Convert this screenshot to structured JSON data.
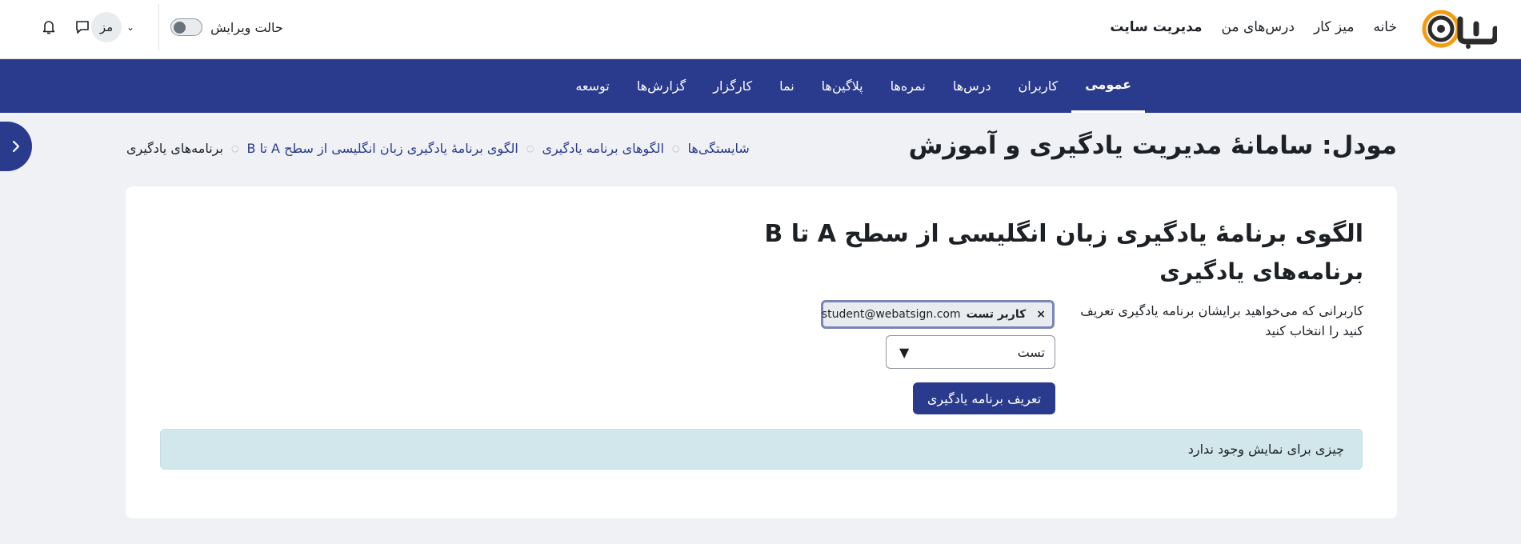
{
  "topbar": {
    "nav": [
      "خانه",
      "میز کار",
      "درس‌های من",
      "مدیریت سایت"
    ],
    "active_nav_index": 3,
    "edit_mode_label": "حالت ویرایش",
    "avatar_initials": "مز"
  },
  "subnav": {
    "items": [
      "عمومی",
      "کاربران",
      "درس‌ها",
      "نمره‌ها",
      "پلاگین‌ها",
      "نما",
      "کارگزار",
      "گزارش‌ها",
      "توسعه"
    ],
    "active_index": 0
  },
  "page": {
    "title": "مودل: سامانهٔ مدیریت یادگیری و آموزش",
    "breadcrumb": [
      "شایستگی‌ها",
      "الگوهای برنامه یادگیری",
      "الگوی برنامهٔ یادگیری زبان انگلیسی از سطح A تا B",
      "برنامه‌های یادگیری"
    ]
  },
  "card": {
    "heading": "الگوی برنامهٔ یادگیری زبان انگلیسی از سطح A تا B",
    "subheading": "برنامه‌های یادگیری",
    "form_label": "کاربرانی که می‌خواهید برایشان برنامه یادگیری تعریف کنید را انتخاب کنید",
    "selected_user": {
      "remove": "×",
      "name": "کاربر تست",
      "email": "student@webatsign.com"
    },
    "search_value": "تست",
    "submit_label": "تعریف برنامه یادگیری",
    "empty_message": "چیزی برای نمایش وجود ندارد"
  },
  "colors": {
    "brand_blue": "#2a3a8c",
    "logo_orange": "#f39c12",
    "alert_bg": "#d1e7eb"
  }
}
